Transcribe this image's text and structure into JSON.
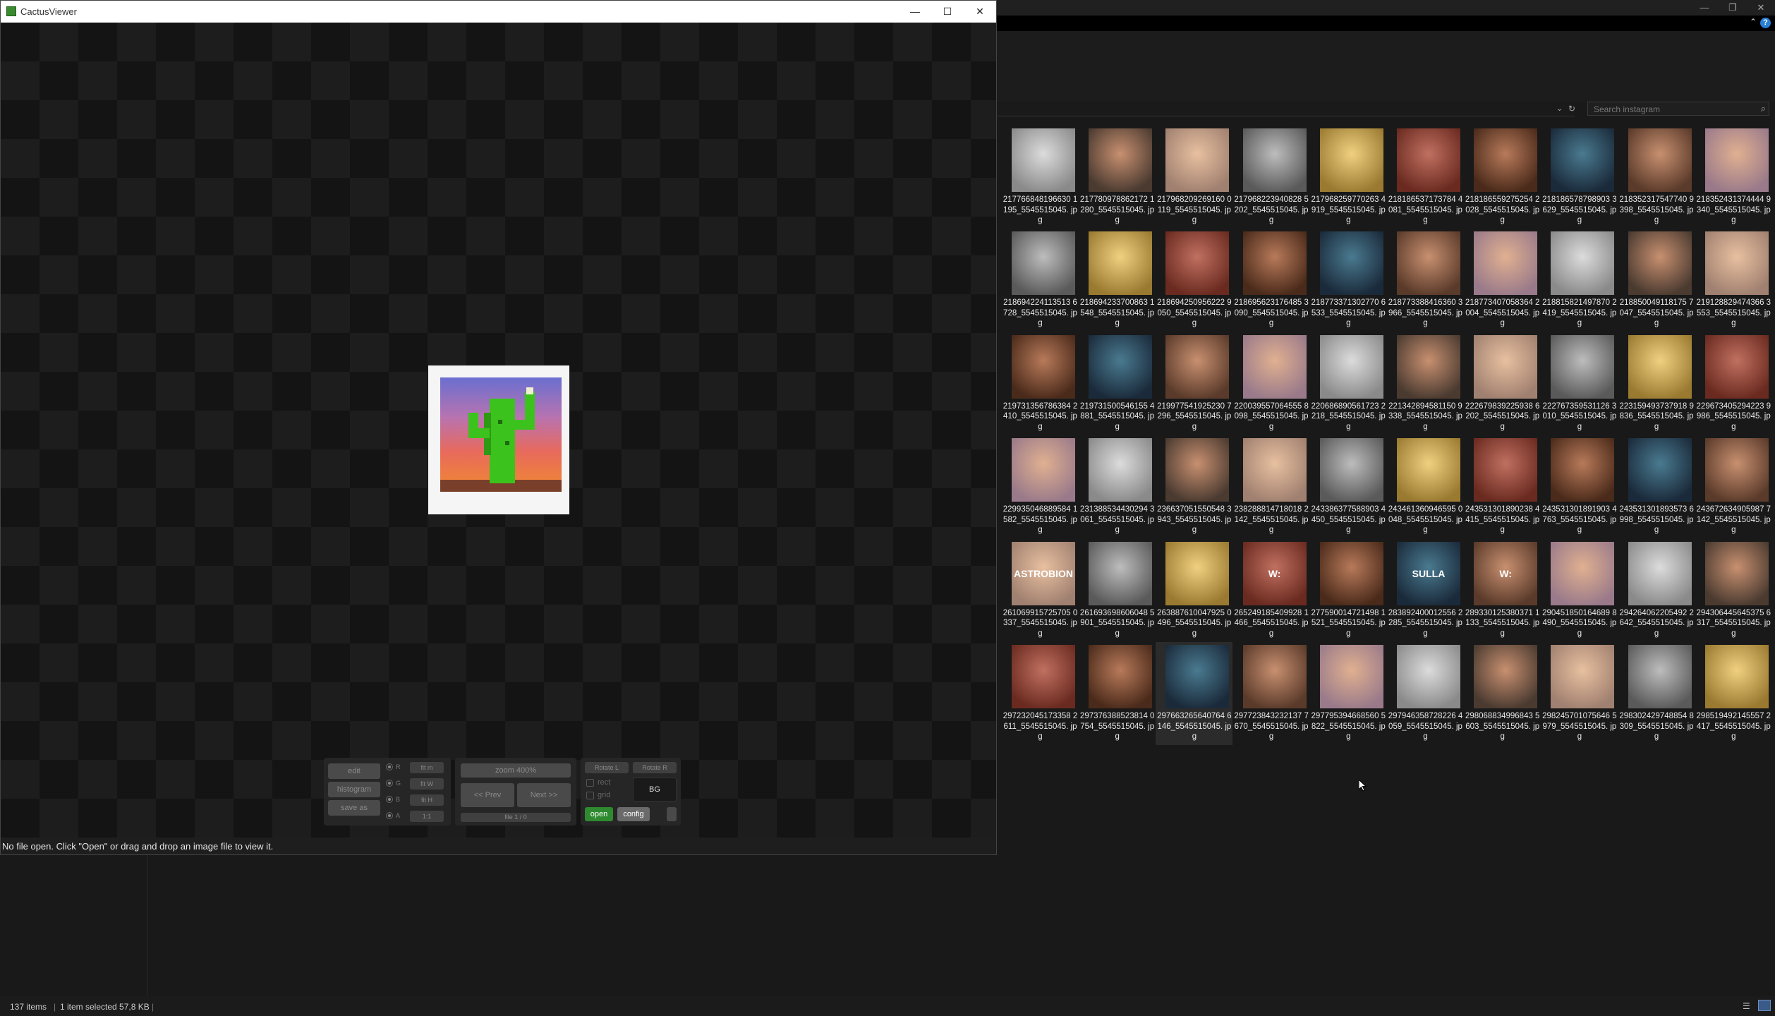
{
  "explorer": {
    "window_controls": {
      "minimize": "—",
      "maximize": "❐",
      "close": "✕"
    },
    "help": "?",
    "search": {
      "placeholder": "Search instagram",
      "value": ""
    },
    "status": {
      "item_count": "137 items",
      "selection": "1 item selected  57,8 KB"
    },
    "thumbnails": [
      {
        "caption": "217766848196630 1195_5545515045. jpg",
        "icon": "photo"
      },
      {
        "caption": "217780978862172 1280_5545515045. jpg",
        "icon": "photo"
      },
      {
        "caption": "217968209269160 0119_5545515045. jpg",
        "icon": "photo"
      },
      {
        "caption": "217968223940828 5202_5545515045. jpg",
        "icon": "photo"
      },
      {
        "caption": "217968259770263 4919_5545515045. jpg",
        "icon": "photo"
      },
      {
        "caption": "218186537173784 4081_5545515045. jpg",
        "icon": "photo"
      },
      {
        "caption": "218186559275254 2028_5545515045. jpg",
        "icon": "photo"
      },
      {
        "caption": "218186578798903 3629_5545515045. jpg",
        "icon": "photo"
      },
      {
        "caption": "218352317547740 9398_5545515045. jpg",
        "icon": "photo"
      },
      {
        "caption": "218352431374444 9340_5545515045. jpg",
        "icon": "photo"
      },
      {
        "caption": "218694224113513 6728_5545515045. jpg",
        "icon": "photo"
      },
      {
        "caption": "218694233700863 1548_5545515045. jpg",
        "icon": "photo"
      },
      {
        "caption": "218694250956222 9050_5545515045. jpg",
        "icon": "photo"
      },
      {
        "caption": "218695623176485 3090_5545515045. jpg",
        "icon": "photo"
      },
      {
        "caption": "218773371302770 6533_5545515045. jpg",
        "icon": "photo"
      },
      {
        "caption": "218773388416360 3966_5545515045. jpg",
        "icon": "photo"
      },
      {
        "caption": "218773407058364 2004_5545515045. jpg",
        "icon": "photo"
      },
      {
        "caption": "218815821497870 2419_5545515045. jpg",
        "icon": "photo"
      },
      {
        "caption": "218850049118175 7047_5545515045. jpg",
        "icon": "photo"
      },
      {
        "caption": "219128829474366 3553_5545515045. jpg",
        "icon": "photo"
      },
      {
        "caption": "219731356786384 2410_5545515045. jpg",
        "icon": "photo"
      },
      {
        "caption": "219731500546155 4881_5545515045. jpg",
        "icon": "photo"
      },
      {
        "caption": "219977541925230 7296_5545515045. jpg",
        "icon": "photo"
      },
      {
        "caption": "220039557064555 8098_5545515045. jpg",
        "icon": "photo"
      },
      {
        "caption": "220686890561723 2218_5545515045. jpg",
        "icon": "photo"
      },
      {
        "caption": "221342894581150 9338_5545515045. jpg",
        "icon": "photo"
      },
      {
        "caption": "222679839225938 6202_5545515045. jpg",
        "icon": "photo"
      },
      {
        "caption": "222767359531126 3010_5545515045. jpg",
        "icon": "photo"
      },
      {
        "caption": "223159493737918 9836_5545515045. jpg",
        "icon": "photo"
      },
      {
        "caption": "229673405294223 9986_5545515045. jpg",
        "icon": "photo"
      },
      {
        "caption": "229935046889584 1582_5545515045. jpg",
        "icon": "photo"
      },
      {
        "caption": "231388534430294 3061_5545515045. jpg",
        "icon": "photo"
      },
      {
        "caption": "236637051550548 3943_5545515045. jpg",
        "icon": "photo"
      },
      {
        "caption": "238288814718018 2142_5545515045. jpg",
        "icon": "photo"
      },
      {
        "caption": "243386377588903 4450_5545515045. jpg",
        "icon": "photo"
      },
      {
        "caption": "243461360946595 0048_5545515045. jpg",
        "icon": "photo"
      },
      {
        "caption": "243531301890238 4415_5545515045. jpg",
        "icon": "photo"
      },
      {
        "caption": "243531301891903 4763_5545515045. jpg",
        "icon": "photo"
      },
      {
        "caption": "243531301893573 6998_5545515045. jpg",
        "icon": "photo"
      },
      {
        "caption": "243672634905987 7142_5545515045. jpg",
        "icon": "photo"
      },
      {
        "caption": "261069915725705 0337_5545515045. jpg",
        "icon": "photo",
        "label": "ASTROBION"
      },
      {
        "caption": "261693698606048 5901_5545515045. jpg",
        "icon": "photo"
      },
      {
        "caption": "263887610047925 0496_5545515045. jpg",
        "icon": "photo"
      },
      {
        "caption": "265249185409928 1466_5545515045. jpg",
        "icon": "photo",
        "label": "W:"
      },
      {
        "caption": "277590014721498 1521_5545515045. jpg",
        "icon": "photo"
      },
      {
        "caption": "283892400012556 2285_5545515045. jpg",
        "icon": "photo",
        "label": "SULLA"
      },
      {
        "caption": "289330125380371 1133_5545515045. jpg",
        "icon": "photo",
        "label": "W:"
      },
      {
        "caption": "290451850164689 8490_5545515045. jpg",
        "icon": "photo"
      },
      {
        "caption": "294264062205492 2642_5545515045. jpg",
        "icon": "photo"
      },
      {
        "caption": "294306445645375 6317_5545515045. jpg",
        "icon": "photo"
      },
      {
        "caption": "297232045173358 2611_5545515045. jpg",
        "icon": "photo"
      },
      {
        "caption": "297376388523814 0754_5545515045. jpg",
        "icon": "photo"
      },
      {
        "caption": "297663265640764 6146_5545515045. jpg",
        "icon": "photo",
        "selected": true
      },
      {
        "caption": "297723843232137 7670_5545515045. jpg",
        "icon": "photo"
      },
      {
        "caption": "297795394668560 5822_5545515045. jpg",
        "icon": "photo"
      },
      {
        "caption": "297946358728226 4059_5545515045. jpg",
        "icon": "photo"
      },
      {
        "caption": "298068834996843 5603_5545515045. jpg",
        "icon": "photo"
      },
      {
        "caption": "298245701075646 5979_5545515045. jpg",
        "icon": "photo"
      },
      {
        "caption": "298302429748854 8309_5545515045. jpg",
        "icon": "photo"
      },
      {
        "caption": "298519492145557 2417_5545515045. jpg",
        "icon": "photo"
      }
    ]
  },
  "cactus": {
    "title": "CactusViewer",
    "window_controls": {
      "minimize": "—",
      "maximize": "☐",
      "close": "✕"
    },
    "status": "No file open. Click \"Open\" or drag and drop an image file to view it.",
    "controls": {
      "edit": "edit",
      "histogram": "histogram",
      "save_as": "save as",
      "channels": [
        "R",
        "G",
        "B",
        "A"
      ],
      "fit": [
        "fit m",
        "fit W",
        "fit H",
        "1:1"
      ],
      "zoom": "zoom 400%",
      "prev": "<< Prev",
      "next": "Next >>",
      "file_counter": "file 1 / 0",
      "rotate_left": "Rotate L",
      "rotate_right": "Rotate R",
      "rect": "rect",
      "grid": "grid",
      "bg": "BG",
      "open": "open",
      "config": "config"
    }
  },
  "colors": {
    "accent_green": "#2f8a2f",
    "selection_blue": "#3a5a88"
  }
}
